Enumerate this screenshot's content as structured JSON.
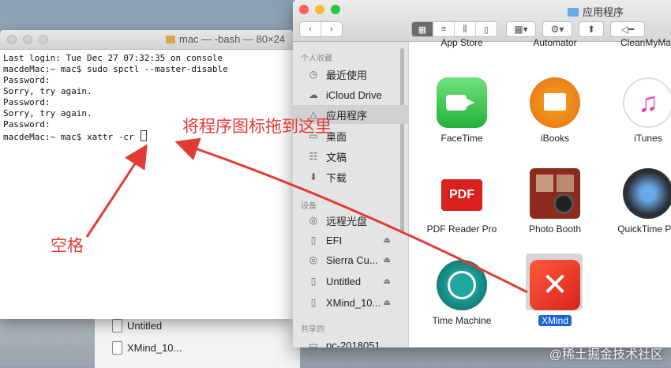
{
  "desktop_window": {
    "items": [
      "Untitled",
      "XMind_10..."
    ]
  },
  "terminal": {
    "title": "mac — -bash — 80×24",
    "lines": [
      "Last login: Tue Dec 27 07:32:35 on console",
      "macdeMac:~ mac$ sudo spctl --master-disable",
      "Password:",
      "Sorry, try again.",
      "Password:",
      "Sorry, try again.",
      "Password:",
      "macdeMac:~ mac$ xattr -cr "
    ]
  },
  "finder": {
    "title": "应用程序",
    "toolbar": {
      "back_icon": "chevron-left-icon",
      "forward_icon": "chevron-right-icon",
      "view_buttons": [
        "icon-view",
        "list-view",
        "column-view",
        "coverflow-view"
      ],
      "arrange_icon": "grid-icon",
      "action_icon": "gear-icon",
      "share_icon": "share-icon",
      "tag_icon": "tag-icon"
    },
    "sidebar": {
      "favorites_header": "个人收藏",
      "favorites": [
        {
          "label": "最近使用",
          "icon": "clock-icon"
        },
        {
          "label": "iCloud Drive",
          "icon": "cloud-icon"
        },
        {
          "label": "应用程序",
          "icon": "applications-icon",
          "selected": true
        },
        {
          "label": "桌面",
          "icon": "desktop-icon"
        },
        {
          "label": "文稿",
          "icon": "documents-icon"
        },
        {
          "label": "下载",
          "icon": "download-icon"
        }
      ],
      "devices_header": "设备",
      "devices": [
        {
          "label": "远程光盘",
          "icon": "disc-icon"
        },
        {
          "label": "EFI",
          "icon": "drive-icon",
          "eject": true
        },
        {
          "label": "Sierra Cu...",
          "icon": "disc-icon",
          "eject": true
        },
        {
          "label": "Untitled",
          "icon": "drive-icon",
          "eject": true
        },
        {
          "label": "XMind_10...",
          "icon": "drive-icon",
          "eject": true
        }
      ],
      "shared_header": "共享的",
      "shared": [
        {
          "label": "pc-2018051...",
          "icon": "computer-icon"
        }
      ]
    },
    "apps_top_partial": [
      "App Store",
      "Automator",
      "CleanMyMac"
    ],
    "apps": [
      {
        "label": "FaceTime",
        "icon": "facetime-icon"
      },
      {
        "label": "iBooks",
        "icon": "ibooks-icon"
      },
      {
        "label": "iTunes",
        "icon": "itunes-icon"
      },
      {
        "label": "PDF Reader Pro",
        "icon": "pdf-icon"
      },
      {
        "label": "Photo Booth",
        "icon": "photo-booth-icon"
      },
      {
        "label": "QuickTime Pla",
        "icon": "quicktime-icon"
      },
      {
        "label": "Time Machine",
        "icon": "time-machine-icon"
      },
      {
        "label": "XMind",
        "icon": "xmind-icon",
        "selected": true
      }
    ]
  },
  "annotations": {
    "drag_hint": "将程序图标拖到这里",
    "space_hint": "空格",
    "color": "#e23b35"
  },
  "watermark": "@稀土掘金技术社区"
}
